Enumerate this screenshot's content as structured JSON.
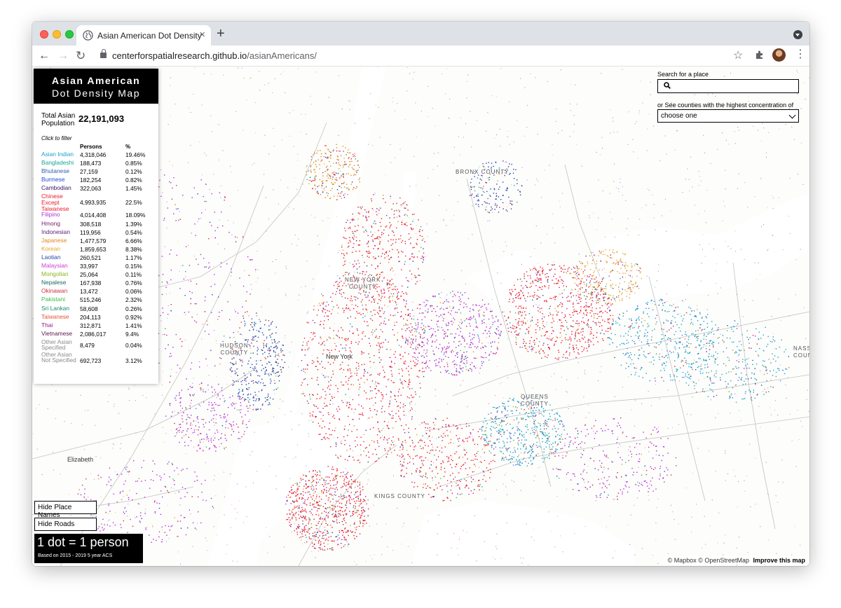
{
  "browser": {
    "tab_title": "Asian American Dot Density",
    "url_domain": "centerforspatialresearch.github.io",
    "url_path": "/asianAmericans/"
  },
  "legend": {
    "title_line1": "Asian American",
    "title_line2": "Dot Density Map",
    "total_label": "Total Asian Population",
    "total_value": "22,191,093",
    "filter_hint": "Click to filter",
    "col_persons": "Persons",
    "col_pct": "%",
    "rows": [
      {
        "name": "Asian Indian",
        "persons": "4,318,046",
        "pct": "19.46%",
        "color": "#1aa3c9",
        "lines": 1
      },
      {
        "name": "Bangladeshi",
        "persons": "188,473",
        "pct": "0.85%",
        "color": "#16a39a",
        "lines": 1
      },
      {
        "name": "Bhutanese",
        "persons": "27,159",
        "pct": "0.12%",
        "color": "#2d5ca8",
        "lines": 1
      },
      {
        "name": "Burmese",
        "persons": "182,254",
        "pct": "0.82%",
        "color": "#1f4fd8",
        "lines": 1
      },
      {
        "name": "Cambodian",
        "persons": "322,063",
        "pct": "1.45%",
        "color": "#3a1266",
        "lines": 1
      },
      {
        "name": "Chinese Except Taiwanese",
        "persons": "4,993,935",
        "pct": "22.5%",
        "color": "#ea1c2c",
        "lines": 3
      },
      {
        "name": "Filipino",
        "persons": "4,014,408",
        "pct": "18.09%",
        "color": "#b22fd6",
        "lines": 1
      },
      {
        "name": "Hmong",
        "persons": "308,518",
        "pct": "1.39%",
        "color": "#7a1a6a",
        "lines": 1
      },
      {
        "name": "Indonesian",
        "persons": "119,956",
        "pct": "0.54%",
        "color": "#5a1a7a",
        "lines": 1
      },
      {
        "name": "Japanese",
        "persons": "1,477,579",
        "pct": "6.66%",
        "color": "#e08a1e",
        "lines": 1
      },
      {
        "name": "Korean",
        "persons": "1,859,653",
        "pct": "8.38%",
        "color": "#e8a52a",
        "lines": 1
      },
      {
        "name": "Laotian",
        "persons": "260,521",
        "pct": "1.17%",
        "color": "#2646a8",
        "lines": 1
      },
      {
        "name": "Malaysian",
        "persons": "33,997",
        "pct": "0.15%",
        "color": "#d23ad0",
        "lines": 1
      },
      {
        "name": "Mongolian",
        "persons": "25,064",
        "pct": "0.11%",
        "color": "#8bb51c",
        "lines": 1
      },
      {
        "name": "Nepalese",
        "persons": "167,938",
        "pct": "0.76%",
        "color": "#1a6a5a",
        "lines": 1
      },
      {
        "name": "Okinawan",
        "persons": "13,472",
        "pct": "0.06%",
        "color": "#d0304a",
        "lines": 1
      },
      {
        "name": "Pakistani",
        "persons": "515,246",
        "pct": "2.32%",
        "color": "#3cbf4a",
        "lines": 1
      },
      {
        "name": "Sri Lankan",
        "persons": "58,608",
        "pct": "0.26%",
        "color": "#1a8a6a",
        "lines": 1
      },
      {
        "name": "Taiwanese",
        "persons": "204,113",
        "pct": "0.92%",
        "color": "#e8503a",
        "lines": 1
      },
      {
        "name": "Thai",
        "persons": "312,871",
        "pct": "1.41%",
        "color": "#8a1a8a",
        "lines": 1
      },
      {
        "name": "Vietnamese",
        "persons": "2,086,017",
        "pct": "9.4%",
        "color": "#5a1a4a",
        "lines": 1
      },
      {
        "name": "Other Asian Specified",
        "persons": "8,479",
        "pct": "0.04%",
        "color": "#8a8a8a",
        "lines": 2
      },
      {
        "name": "Other Asian Not Specified",
        "persons": "692,723",
        "pct": "3.12%",
        "color": "#8a8a8a",
        "lines": 3
      }
    ]
  },
  "search": {
    "label": "Search for a place",
    "placeholder": "",
    "county_label": "or See counties with the highest concentration of",
    "county_selected": "choose one"
  },
  "controls": {
    "hide_place_names": "Hide Place Names",
    "hide_roads": "Hide Roads"
  },
  "scale": {
    "title": "1 dot = 1 person",
    "subtitle": "Based on 2015 - 2019 5 year ACS"
  },
  "map_labels": {
    "bronx": "BRONX COUNTY",
    "new_york_county_1": "NEW YORK",
    "new_york_county_2": "COUNTY",
    "new_york_city": "New York",
    "hudson_1": "HUDSON",
    "hudson_2": "COUNTY",
    "queens_1": "QUEENS",
    "queens_2": "COUNTY",
    "kings": "KINGS COUNTY",
    "elizabeth": "Elizabeth",
    "nassau_1": "NASS",
    "nassau_2": "COUN"
  },
  "attribution": {
    "mapbox": "© Mapbox",
    "osm": "© OpenStreetMap",
    "improve": "Improve this map"
  }
}
